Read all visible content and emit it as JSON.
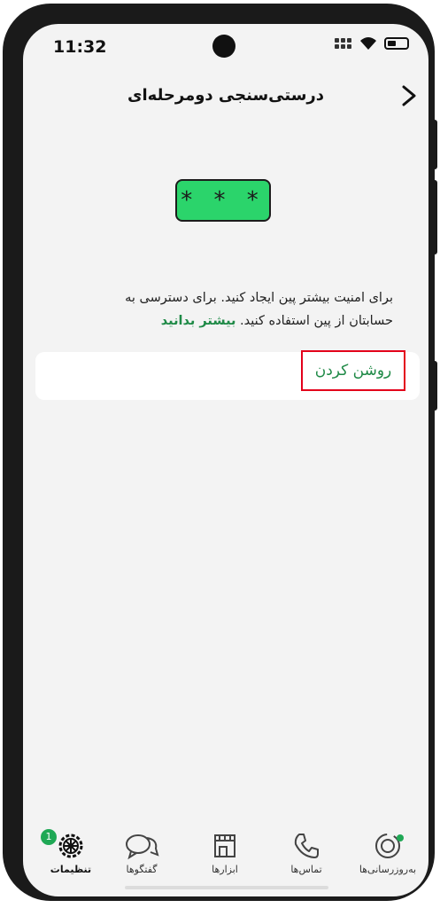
{
  "status": {
    "time": "11:32"
  },
  "header": {
    "title": "درستی‌سنجی دومرحله‌ای"
  },
  "pin_badge": {
    "text": "* * *"
  },
  "description": {
    "text": "برای امنیت بیشتر پین ایجاد کنید. برای دسترسی به حسابتان از پین استفاده کنید.",
    "link": "بیشتر بدانید"
  },
  "action": {
    "turn_on_label": "روشن کردن"
  },
  "nav": {
    "items": [
      {
        "label": "به‌روزرسانی‌ها",
        "icon": "updates-icon"
      },
      {
        "label": "تماس‌ها",
        "icon": "phone-icon"
      },
      {
        "label": "ابزارها",
        "icon": "store-icon"
      },
      {
        "label": "گفتگوها",
        "icon": "chats-icon"
      },
      {
        "label": "تنظیمات",
        "icon": "gear-icon",
        "badge": "1",
        "active": true
      }
    ]
  },
  "colors": {
    "accent": "#1f8a47",
    "pin_green": "#2bd46b",
    "highlight": "#e3001b"
  }
}
